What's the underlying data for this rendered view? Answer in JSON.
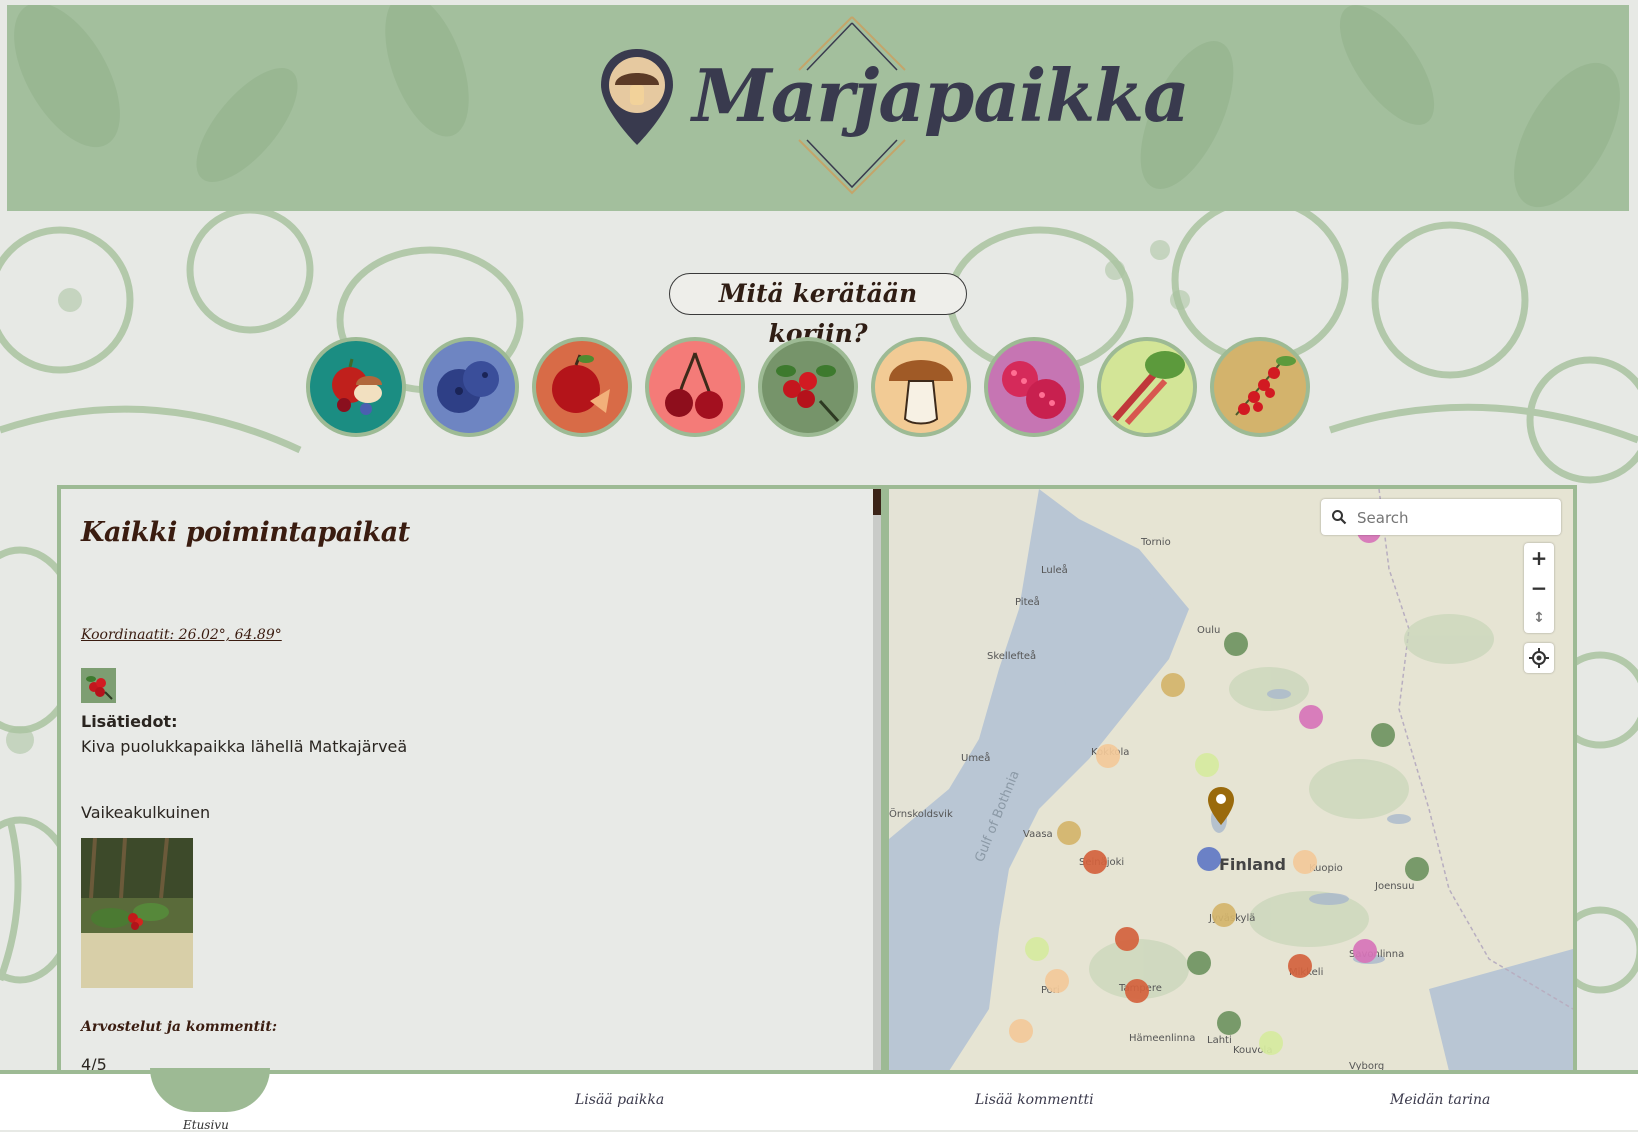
{
  "header": {
    "brand": "Marjapaikka",
    "brand_color": "#393a4e",
    "background_color": "#a3bf9d"
  },
  "categories_section": {
    "title": "Mitä kerätään koriin?",
    "items": [
      {
        "name": "all-icon",
        "bg": "#1b8d82"
      },
      {
        "name": "blueberry-icon",
        "bg": "#6e85c2"
      },
      {
        "name": "apple-icon",
        "bg": "#d86b47"
      },
      {
        "name": "cherry-icon",
        "bg": "#f47b78"
      },
      {
        "name": "lingonberry-icon",
        "bg": "#76946a"
      },
      {
        "name": "mushroom-icon",
        "bg": "#f2cb95"
      },
      {
        "name": "raspberry-icon",
        "bg": "#c675b3"
      },
      {
        "name": "rhubarb-icon",
        "bg": "#d3e597"
      },
      {
        "name": "redcurrant-icon",
        "bg": "#d3b36c"
      }
    ]
  },
  "list_panel": {
    "title": "Kaikki poimintapaikat",
    "entry": {
      "coordinates": "Koordinaatit: 26.02°, 64.89°",
      "berry_icon": "lingonberry-icon",
      "info_label": "Lisätiedot:",
      "info_text": "Kiva puolukkapaikka lähellä Matkajärveä",
      "difficulty": "Vaikeakulkuinen",
      "reviews_label": "Arvostelut ja kommentit:",
      "rating": "4/5"
    }
  },
  "map": {
    "search": {
      "placeholder": "Search",
      "value": ""
    },
    "controls": {
      "zoom_in": "+",
      "zoom_out": "−",
      "compass": "↕",
      "locate": "locate-icon"
    },
    "labels": {
      "country": "Finland",
      "sea": "Gulf of Bothnia",
      "tornio": "Tornio",
      "lulea": "Luleå",
      "pitea": "Piteå",
      "skelleftea": "Skellefteå",
      "oulu": "Oulu",
      "umea": "Umeå",
      "ornskoldsvik": "Örnskoldsvik",
      "vaasa": "Vaasa",
      "seinajoki": "Seinäjoki",
      "kokkola": "Kokkola",
      "kuopio": "Kuopio",
      "joensuu": "Joensuu",
      "jyvaskyla": "Jyväskylä",
      "pori": "Pori",
      "tampere": "Tampere",
      "mikkeli": "Mikkeli",
      "savonlinna": "Savonlinna",
      "hameenlinna": "Hämeenlinna",
      "lahti": "Lahti",
      "kouvola": "Kouvola",
      "vyborg": "Vyborg"
    },
    "marker_colors": {
      "pink": "#d774b8",
      "green": "#6f9461",
      "mustard": "#d4b46a",
      "peach": "#f3c999",
      "lime": "#d6ea9e",
      "blue": "#6178c4",
      "orange": "#d4623d",
      "selected_pin": "#9a6a0c"
    }
  },
  "bottom_nav": {
    "items": [
      {
        "label": "Etusivu",
        "active": true
      },
      {
        "label": "Lisää paikka",
        "active": false
      },
      {
        "label": "Lisää kommentti",
        "active": false
      },
      {
        "label": "Meidän tarina",
        "active": false
      }
    ]
  }
}
